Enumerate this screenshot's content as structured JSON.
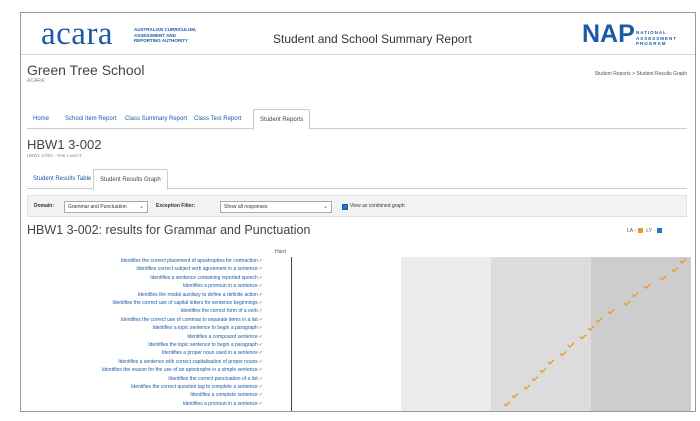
{
  "header": {
    "acara_logo_text": "acara",
    "acara_logo_sub_1": "AUSTRALIAN CURRICULUM,",
    "acara_logo_sub_2": "ASSESSMENT AND",
    "acara_logo_sub_3": "REPORTING AUTHORITY",
    "report_title": "Student and School Summary Report",
    "nap_logo_text": "NAP",
    "nap_logo_sub_1": "NATIONAL",
    "nap_logo_sub_2": "ASSESSMENT",
    "nap_logo_sub_3": "PROGRAM"
  },
  "school": {
    "name": "Green Tree School",
    "sub": "ACARA",
    "breadcrumb": "Student Reports > Student Results Graph"
  },
  "tabs_top": [
    {
      "label": "Home",
      "active": false
    },
    {
      "label": "School Item Report",
      "active": false
    },
    {
      "label": "Class Summary Report",
      "active": false
    },
    {
      "label": "Class Test Report",
      "active": false
    },
    {
      "label": "Student Reports",
      "active": true
    }
  ],
  "test": {
    "title": "HBW1 3-002",
    "sub": "HBW1 3-002 - Year Level 3"
  },
  "tabs_mid": [
    {
      "label": "Student Results Table",
      "active": false
    },
    {
      "label": "Student Results Graph",
      "active": true
    }
  ],
  "filters": {
    "domain_label": "Domain:",
    "domain_value": "Grammar and Punctuation",
    "exception_label": "Exception Filter:",
    "exception_value": "Show all responses",
    "combined_label": "View as combined graph",
    "combined_checked": true
  },
  "results": {
    "title": "HBW1 3-002: results for Grammar and Punctuation",
    "legend": [
      {
        "label": "LA -",
        "color": "#e89b1d"
      },
      {
        "label": "LY -",
        "color": "#1e78c8"
      }
    ],
    "hard_label": "Hard",
    "tick_glyph": "✔"
  },
  "chart_data": {
    "type": "scatter",
    "categories": [
      "Identifies the correct placement of apostrophes for contraction",
      "Identifies correct subject verb agreement in a sentence",
      "Identifies a sentence containing reported speech",
      "Identifies a pronoun in a sentence",
      "Identifies the modal auxiliary to define a definite action",
      "Identifies the correct use of capital letters for sentence beginnings",
      "Identifies the correct form of a verb",
      "Identifies the correct use of commas to separate items in a list",
      "Identifies a topic sentence to begin a paragraph",
      "Identifies a compound sentence",
      "Identifies the topic sentence to begin a paragraph",
      "Identifies a proper noun used in a sentence",
      "Identifies a sentence with correct capitalisation of proper nouns",
      "Identifies the reason for the use of an apostrophe in a simple sentence",
      "Identifies the correct punctuation of a list",
      "Identifies the correct question tag to complete a sentence",
      "Identifies a complete sentence",
      "Identifies a pronoun in a sentence"
    ],
    "band_colors": [
      "#ffffff",
      "#ececec",
      "#dcdcdc",
      "#cdcdcd"
    ],
    "marker_color": "#e89b1d",
    "item_positions": [
      0.98,
      0.96,
      0.93,
      0.89,
      0.86,
      0.84,
      0.8,
      0.77,
      0.75,
      0.73,
      0.7,
      0.68,
      0.65,
      0.63,
      0.61,
      0.59,
      0.56,
      0.54
    ]
  }
}
